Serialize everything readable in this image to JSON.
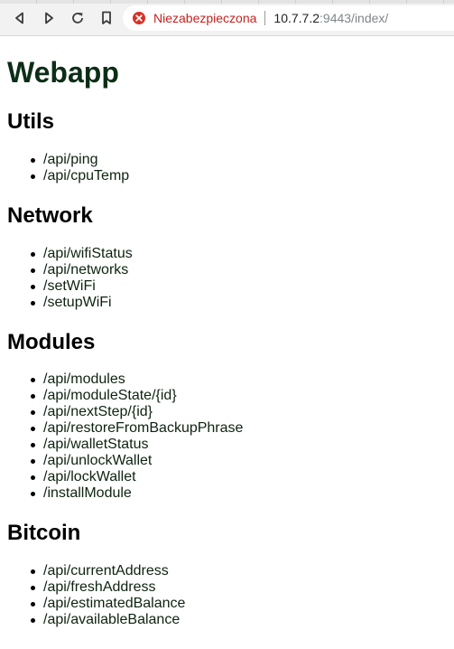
{
  "browser": {
    "security_label": "Niezabezpieczona",
    "url_host": "10.7.7.2",
    "url_rest": ":9443/index/"
  },
  "page": {
    "title": "Webapp",
    "sections": [
      {
        "heading": "Utils",
        "links": [
          "/api/ping",
          "/api/cpuTemp"
        ]
      },
      {
        "heading": "Network",
        "links": [
          "/api/wifiStatus",
          "/api/networks",
          "/setWiFi",
          "/setupWiFi"
        ]
      },
      {
        "heading": "Modules",
        "links": [
          "/api/modules",
          "/api/moduleState/{id}",
          "/api/nextStep/{id}",
          "/api/restoreFromBackupPhrase",
          "/api/walletStatus",
          "/api/unlockWallet",
          "/api/lockWallet",
          "/installModule"
        ]
      },
      {
        "heading": "Bitcoin",
        "links": [
          "/api/currentAddress",
          "/api/freshAddress",
          "/api/estimatedBalance",
          "/api/availableBalance"
        ]
      }
    ]
  }
}
